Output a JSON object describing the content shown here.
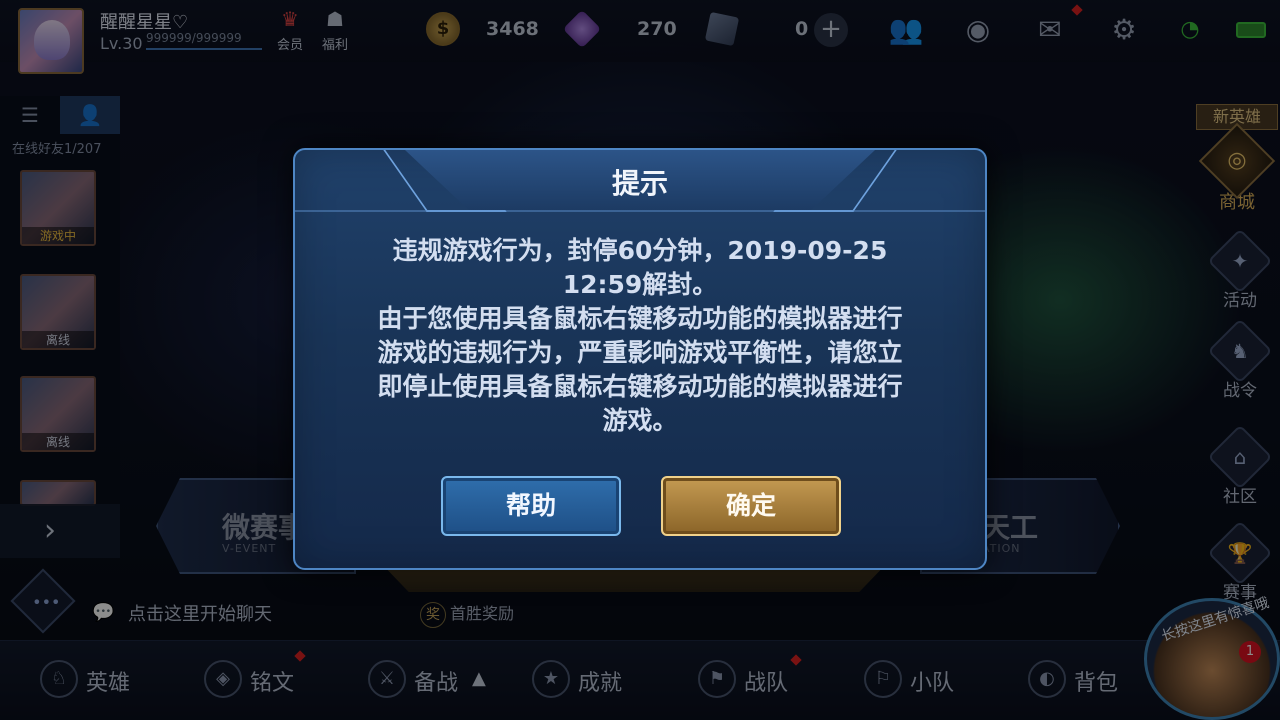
{
  "player": {
    "name": "醒醒星星♡",
    "level": "Lv.30",
    "exp": "999999/999999",
    "vip_label": "会员",
    "welfare_label": "福利"
  },
  "currency": {
    "gold": "3468",
    "gems": "270",
    "cards": "0"
  },
  "top_icons": [
    "friends-icon",
    "eye-icon",
    "mail-icon",
    "gear-icon",
    "wifi-icon",
    "battery-icon"
  ],
  "friends_panel": {
    "online_count": "在线好友1/207",
    "friends": [
      {
        "status": "游戏中"
      },
      {
        "status": "离线"
      },
      {
        "status": "离线"
      }
    ]
  },
  "chat": {
    "placeholder": "点击这里开始聊天",
    "first_win": "首胜奖励"
  },
  "banners": {
    "left_title": "微赛事",
    "left_sub": "V-EVENT",
    "right_title": "天工",
    "right_sub": "ATION"
  },
  "right_menu": {
    "new_hero": "新英雄",
    "shop": "商城",
    "items": [
      "活动",
      "战令",
      "社区",
      "赛事"
    ]
  },
  "bottom_nav": [
    "英雄",
    "铭文",
    "备战",
    "成就",
    "战队",
    "小队",
    "背包"
  ],
  "helper": {
    "text": "长按这里有惊喜哦",
    "badge": "1"
  },
  "dialog": {
    "title": "提示",
    "line1": "违规游戏行为，封停60分钟，2019-09-25",
    "line2": "12:59解封。",
    "line3": "由于您使用具备鼠标右键移动功能的模拟器进行",
    "line4": "游戏的违规行为，严重影响游戏平衡性，请您立",
    "line5": "即停止使用具备鼠标右键移动功能的模拟器进行",
    "line6": "游戏。",
    "help_button": "帮助",
    "ok_button": "确定"
  },
  "colors": {
    "dialog_border": "#4e86c4",
    "help_button": "#2f6eac",
    "ok_button": "#c49a52"
  }
}
